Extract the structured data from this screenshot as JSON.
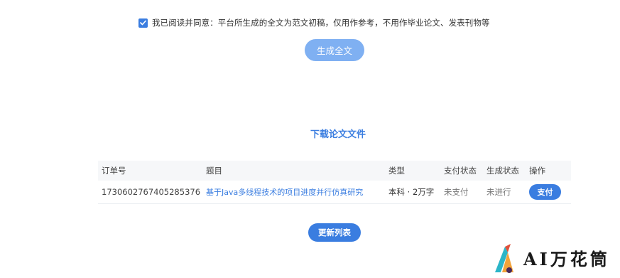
{
  "agreement": {
    "checked": true,
    "text": "我已阅读并同意：平台所生成的全文为范文初稿，仅用作参考，不用作毕业论文、发表刊物等"
  },
  "generate_button": "生成全文",
  "section_title": "下载论文文件",
  "table": {
    "headers": {
      "order": "订单号",
      "title": "题目",
      "type": "类型",
      "pay_status": "支付状态",
      "gen_status": "生成状态",
      "action": "操作"
    },
    "rows": [
      {
        "order": "1730602767405285376",
        "title": "基于Java多线程技术的项目进度并行仿真研究",
        "type": "本科 · 2万字",
        "pay_status": "未支付",
        "gen_status": "未进行",
        "action": "支付"
      }
    ]
  },
  "refresh_button": "更新列表",
  "watermark": {
    "text": "AI万花筒"
  },
  "colors": {
    "accent": "#3a7de0",
    "accent_light": "#7fb0f2"
  }
}
